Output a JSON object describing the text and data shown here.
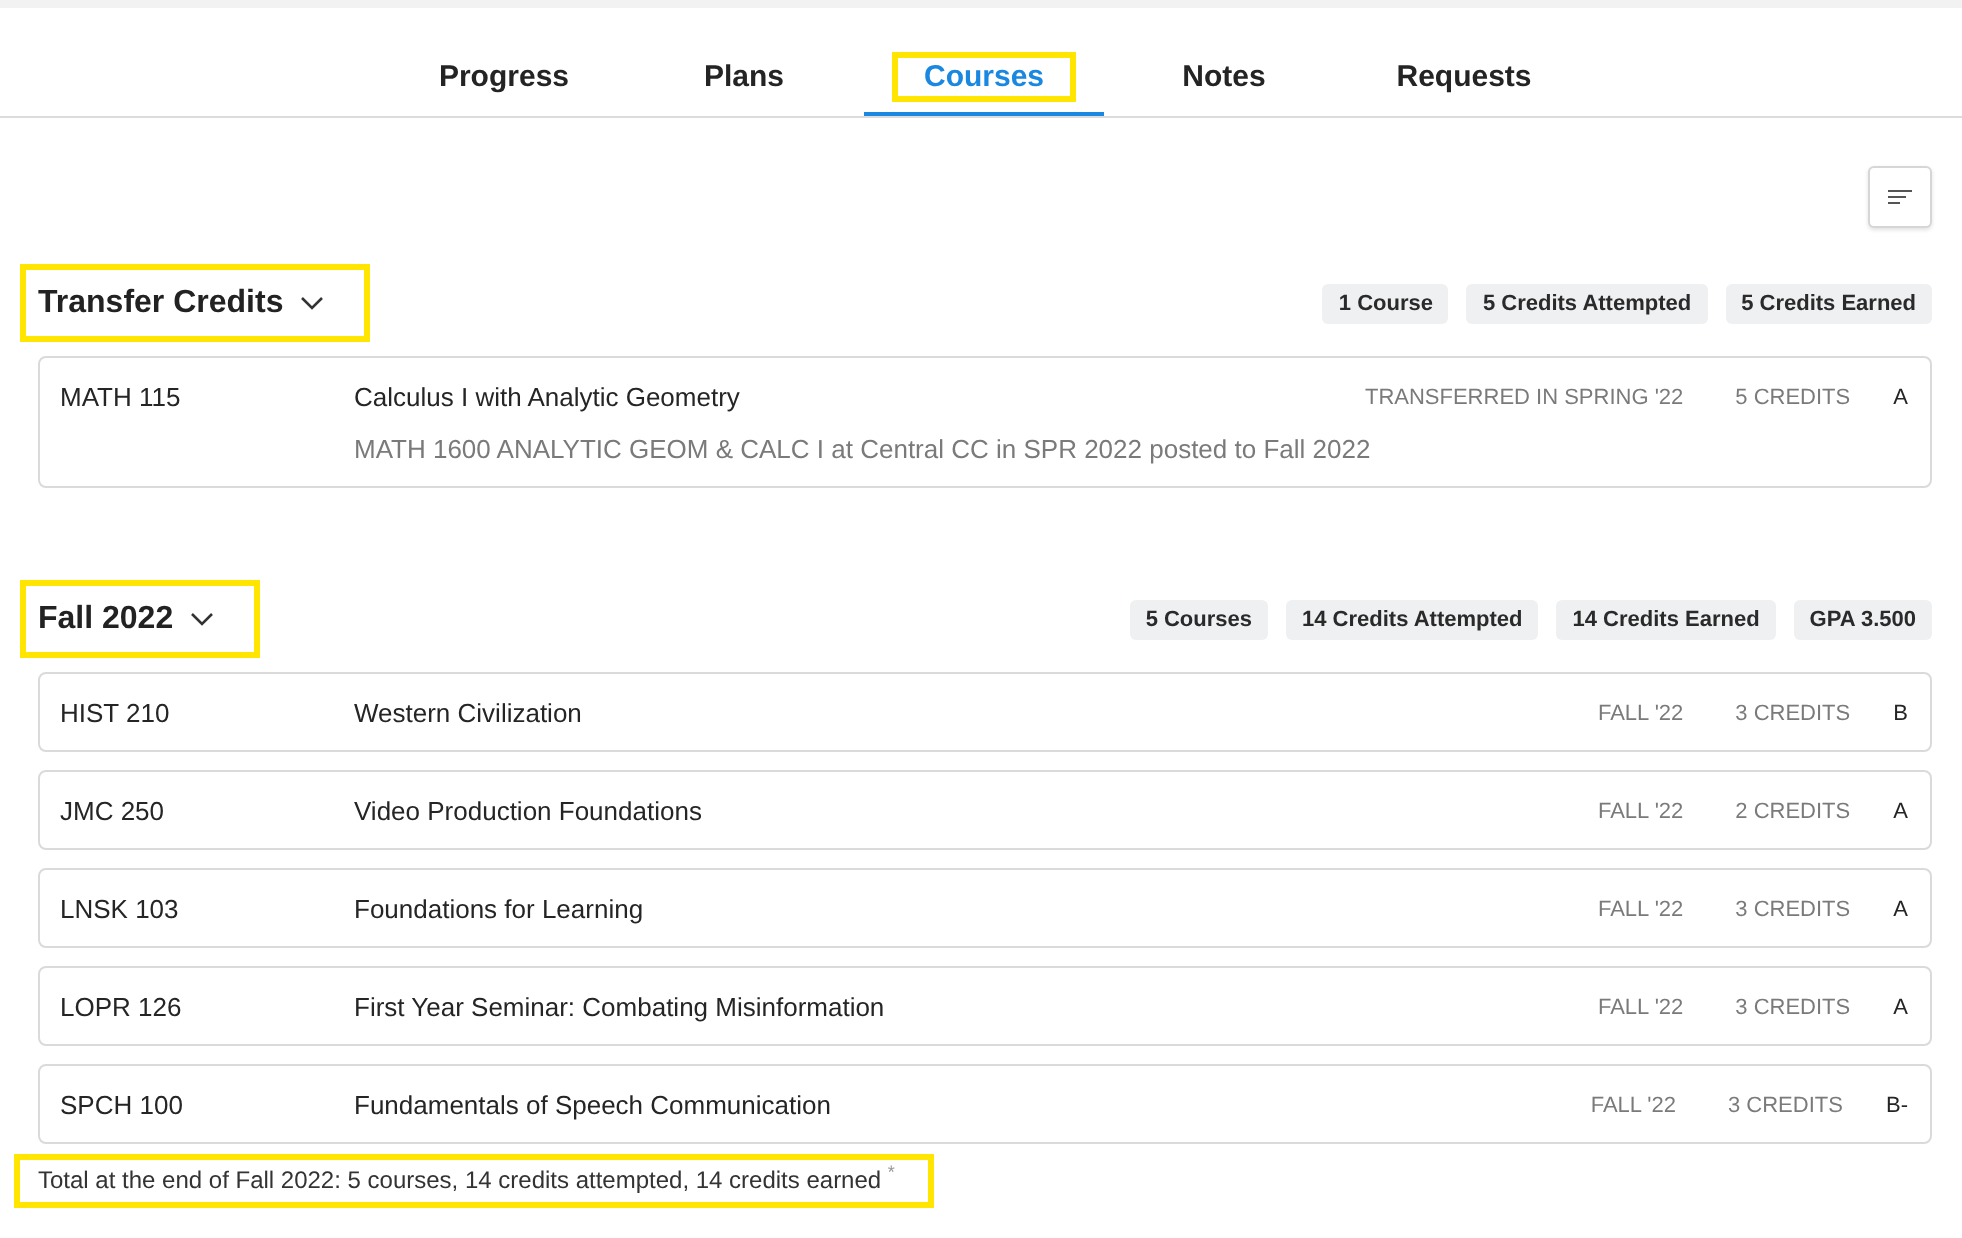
{
  "tabs": [
    {
      "label": "Progress",
      "selected": false,
      "highlighted": false
    },
    {
      "label": "Plans",
      "selected": false,
      "highlighted": false
    },
    {
      "label": "Courses",
      "selected": true,
      "highlighted": true
    },
    {
      "label": "Notes",
      "selected": false,
      "highlighted": false
    },
    {
      "label": "Requests",
      "selected": false,
      "highlighted": false
    }
  ],
  "sections": [
    {
      "title": "Transfer Credits",
      "expanded": true,
      "highlighted": true,
      "badges": [
        "1 Course",
        "5 Credits Attempted",
        "5 Credits Earned"
      ],
      "courses": [
        {
          "code": "MATH 115",
          "title": "Calculus I with Analytic Geometry",
          "note": "MATH 1600 ANALYTIC GEOM & CALC I at Central CC in SPR 2022 posted to Fall 2022",
          "term": "TRANSFERRED IN SPRING '22",
          "credits": "5 CREDITS",
          "grade": "A"
        }
      ]
    },
    {
      "title": "Fall 2022",
      "expanded": true,
      "highlighted": true,
      "badges": [
        "5 Courses",
        "14 Credits Attempted",
        "14 Credits Earned",
        "GPA 3.500"
      ],
      "courses": [
        {
          "code": "HIST 210",
          "title": "Western Civilization",
          "term": "FALL '22",
          "credits": "3 CREDITS",
          "grade": "B"
        },
        {
          "code": "JMC 250",
          "title": "Video Production Foundations",
          "term": "FALL '22",
          "credits": "2 CREDITS",
          "grade": "A"
        },
        {
          "code": "LNSK 103",
          "title": "Foundations for Learning",
          "term": "FALL '22",
          "credits": "3 CREDITS",
          "grade": "A"
        },
        {
          "code": "LOPR 126",
          "title": "First Year Seminar: Combating Misinformation",
          "term": "FALL '22",
          "credits": "3 CREDITS",
          "grade": "A"
        },
        {
          "code": "SPCH 100",
          "title": "Fundamentals of Speech Communication",
          "term": "FALL '22",
          "credits": "3 CREDITS",
          "grade": "B-"
        }
      ],
      "total": {
        "text": "Total at the end of Fall 2022: 5 courses, 14 credits attempted, 14 credits earned $^{*}$",
        "highlighted": true
      }
    }
  ]
}
